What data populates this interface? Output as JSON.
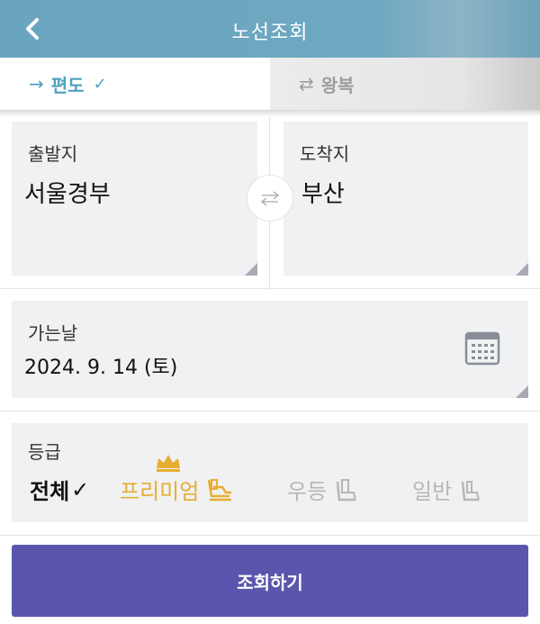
{
  "header": {
    "title": "노선조회",
    "back_icon": "chevron-left-icon"
  },
  "tabs": {
    "oneway": {
      "label": "편도",
      "icon": "arrow-right-icon",
      "selected": true
    },
    "roundtrip": {
      "label": "왕복",
      "icon": "swap-arrows-icon",
      "selected": false
    }
  },
  "departure": {
    "label": "출발지",
    "value": "서울경부"
  },
  "arrival": {
    "label": "도착지",
    "value": "부산"
  },
  "date": {
    "label": "가는날",
    "value": "2024. 9. 14 (토)",
    "icon": "calendar-icon"
  },
  "grade": {
    "label": "등급",
    "options": [
      {
        "label": "전체",
        "selected": true
      },
      {
        "label": "프리미엄",
        "icon": "premium-seat-icon",
        "badge": "crown-icon",
        "color": "#e7ad30"
      },
      {
        "label": "우등",
        "icon": "first-seat-icon",
        "color": "#b7b7b7"
      },
      {
        "label": "일반",
        "icon": "normal-seat-icon",
        "color": "#b7b7b7"
      }
    ]
  },
  "search_button": {
    "label": "조회하기"
  },
  "colors": {
    "header": "#6aa5bf",
    "accent": "#4fa2c0",
    "button": "#5a56ae",
    "premium": "#e7ad30"
  }
}
